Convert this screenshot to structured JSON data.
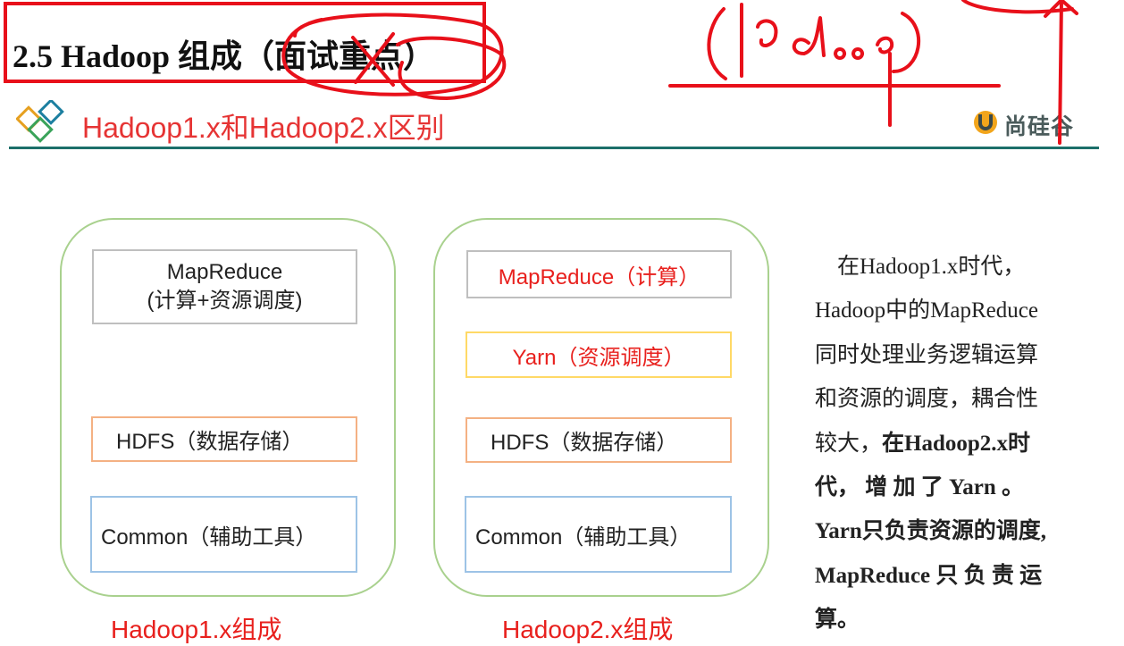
{
  "slide": {
    "title": "2.5 Hadoop 组成（面试重点）",
    "section_title": "Hadoop1.x和Hadoop2.x区别",
    "logo_text": "尚硅谷",
    "colors": {
      "accent_red": "#e8101a",
      "rule_teal": "#1c6f6a",
      "panel_green": "#a9d18e"
    }
  },
  "diagram": {
    "hadoop1": {
      "caption": "Hadoop1.x组成",
      "mapreduce": {
        "line1": "MapReduce",
        "line2": "(计算+资源调度)"
      },
      "hdfs": "HDFS（数据存储）",
      "common": "Common（辅助工具）"
    },
    "hadoop2": {
      "caption": "Hadoop2.x组成",
      "mapreduce": "MapReduce（计算）",
      "yarn": "Yarn（资源调度）",
      "hdfs": "HDFS（数据存储）",
      "common": "Common（辅助工具）"
    }
  },
  "description": {
    "lines": [
      {
        "text": "　在Hadoop1.x时代，",
        "bold": false
      },
      {
        "text": "Hadoop中的MapReduce",
        "bold": false
      },
      {
        "text": "同时处理业务逻辑运算",
        "bold": false
      },
      {
        "text": "和资源的调度，耦合性",
        "bold": false
      },
      {
        "text": "较大，",
        "bold": false,
        "bold_tail": "在Hadoop2.x时"
      },
      {
        "text": "代， 增 加 了 Yarn 。",
        "bold": true
      },
      {
        "text": "Yarn只负责资源的调度,",
        "bold": true
      },
      {
        "text": "MapReduce 只 负 责 运",
        "bold": true
      },
      {
        "text": "算。",
        "bold": true
      }
    ]
  },
  "annotations": {
    "handwriting": "Hadoop"
  },
  "icons": {
    "section": "diamond-cluster-icon",
    "logo": "shanggui-logo-icon"
  }
}
